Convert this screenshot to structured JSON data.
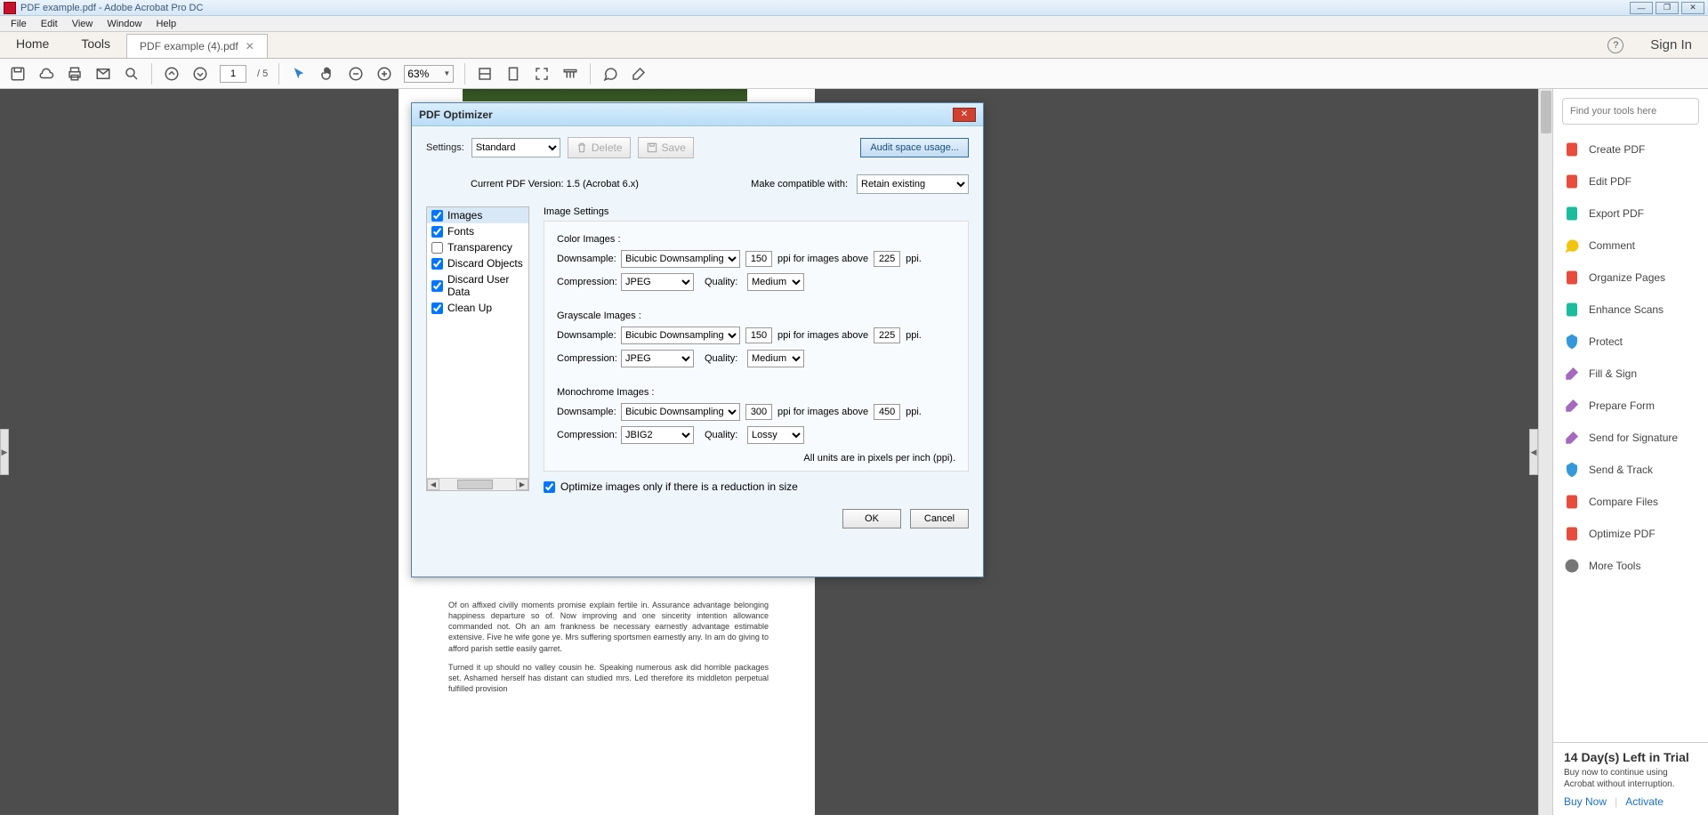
{
  "app": {
    "title": "PDF example.pdf - Adobe Acrobat Pro DC",
    "signin": "Sign In"
  },
  "menu": {
    "file": "File",
    "edit": "Edit",
    "view": "View",
    "window": "Window",
    "help": "Help"
  },
  "tabs": {
    "home": "Home",
    "tools": "Tools",
    "doc": "PDF example (4).pdf"
  },
  "toolbar": {
    "page": "1",
    "page_total": "/ 5",
    "zoom": "63%"
  },
  "doc_paras": {
    "p1": "Of on affixed civilly moments promise explain fertile in. Assurance advantage belonging happiness departure so of. Now improving and one sincerity intention allowance commanded not. Oh an am frankness be necessary earnestly advantage estimable extensive. Five he wife gone ye. Mrs suffering sportsmen earnestly any. In am do giving to afford parish settle easily garret.",
    "p2": "Turned it up should no valley cousin he. Speaking numerous ask did horrible packages set. Ashamed herself has distant can studied mrs. Led therefore its middleton perpetual fulfilled provision"
  },
  "rpanel": {
    "search_ph": "Find your tools here",
    "items": [
      {
        "label": "Create PDF",
        "color": "red"
      },
      {
        "label": "Edit PDF",
        "color": "red"
      },
      {
        "label": "Export PDF",
        "color": "cyan"
      },
      {
        "label": "Comment",
        "color": "yellow"
      },
      {
        "label": "Organize Pages",
        "color": "red"
      },
      {
        "label": "Enhance Scans",
        "color": "cyan"
      },
      {
        "label": "Protect",
        "color": "blue"
      },
      {
        "label": "Fill & Sign",
        "color": "purple"
      },
      {
        "label": "Prepare Form",
        "color": "purple"
      },
      {
        "label": "Send for Signature",
        "color": "purple"
      },
      {
        "label": "Send & Track",
        "color": "blue"
      },
      {
        "label": "Compare Files",
        "color": "red"
      },
      {
        "label": "Optimize PDF",
        "color": "red"
      },
      {
        "label": "More Tools",
        "color": "gray"
      }
    ],
    "trial": {
      "heading": "14 Day(s) Left in Trial",
      "msg": "Buy now to continue using Acrobat without interruption.",
      "buy": "Buy Now",
      "activate": "Activate"
    }
  },
  "dialog": {
    "title": "PDF Optimizer",
    "settings_lbl": "Settings:",
    "settings_val": "Standard",
    "delete": "Delete",
    "save": "Save",
    "audit": "Audit space usage...",
    "current_ver": "Current PDF Version: 1.5 (Acrobat 6.x)",
    "compat_lbl": "Make compatible with:",
    "compat_val": "Retain existing",
    "categories": [
      {
        "label": "Images",
        "checked": true,
        "selected": true
      },
      {
        "label": "Fonts",
        "checked": true
      },
      {
        "label": "Transparency",
        "checked": false
      },
      {
        "label": "Discard Objects",
        "checked": true
      },
      {
        "label": "Discard User Data",
        "checked": true
      },
      {
        "label": "Clean Up",
        "checked": true
      }
    ],
    "pane": {
      "heading": "Image Settings",
      "color": {
        "sub": "Color Images :",
        "ds_lbl": "Downsample:",
        "ds": "Bicubic Downsampling to",
        "ds_val": "150",
        "above": "ppi for images above",
        "above_val": "225",
        "ppi": "ppi.",
        "comp_lbl": "Compression:",
        "comp": "JPEG",
        "q_lbl": "Quality:",
        "q": "Medium"
      },
      "gray": {
        "sub": "Grayscale Images :",
        "ds_lbl": "Downsample:",
        "ds": "Bicubic Downsampling to",
        "ds_val": "150",
        "above": "ppi for images above",
        "above_val": "225",
        "ppi": "ppi.",
        "comp_lbl": "Compression:",
        "comp": "JPEG",
        "q_lbl": "Quality:",
        "q": "Medium"
      },
      "mono": {
        "sub": "Monochrome Images :",
        "ds_lbl": "Downsample:",
        "ds": "Bicubic Downsampling to",
        "ds_val": "300",
        "above": "ppi for images above",
        "above_val": "450",
        "ppi": "ppi.",
        "comp_lbl": "Compression:",
        "comp": "JBIG2",
        "q_lbl": "Quality:",
        "q": "Lossy"
      },
      "units": "All units are in pixels per inch (ppi)."
    },
    "opt_chk": "Optimize images only if there is a reduction in size",
    "ok": "OK",
    "cancel": "Cancel"
  }
}
